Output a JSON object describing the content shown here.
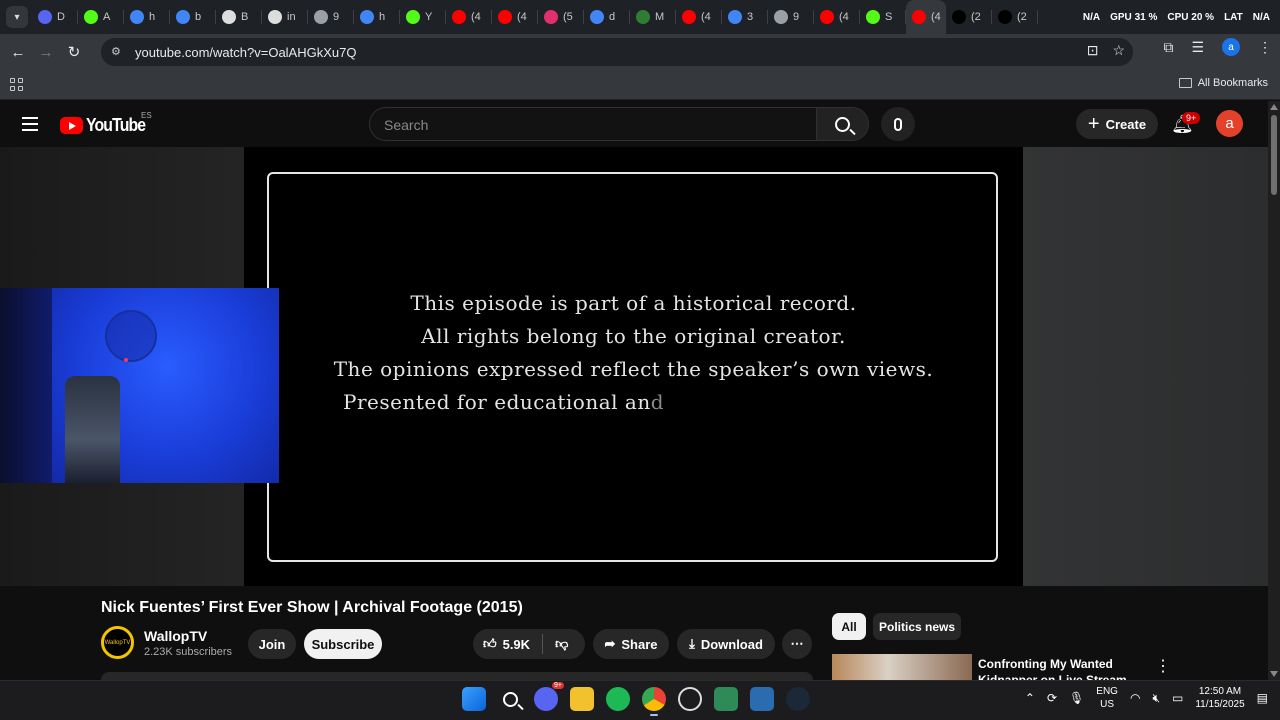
{
  "browser": {
    "tabs": [
      {
        "label": "D",
        "fav": "discord-icon",
        "color": "#5865f2"
      },
      {
        "label": "A",
        "fav": "kick-icon",
        "color": "#53fc18"
      },
      {
        "label": "h",
        "fav": "google-icon",
        "color": "#4285f4"
      },
      {
        "label": "b",
        "fav": "google-icon",
        "color": "#4285f4"
      },
      {
        "label": "B",
        "fav": "bold-b-icon",
        "color": "#dddddd"
      },
      {
        "label": "in",
        "fav": "bold-b-icon",
        "color": "#dddddd"
      },
      {
        "label": "9",
        "fav": "globe-icon",
        "color": "#9aa0a6"
      },
      {
        "label": "h",
        "fav": "google-icon",
        "color": "#4285f4"
      },
      {
        "label": "Y",
        "fav": "kick-icon",
        "color": "#53fc18"
      },
      {
        "label": "(4",
        "fav": "youtube-icon",
        "color": "#ff0000"
      },
      {
        "label": "(4",
        "fav": "youtube-icon",
        "color": "#ff0000"
      },
      {
        "label": "(5",
        "fav": "instagram-icon",
        "color": "#e1306c"
      },
      {
        "label": "d",
        "fav": "google-icon",
        "color": "#4285f4"
      },
      {
        "label": "M",
        "fav": "ship-icon",
        "color": "#2e7d32"
      },
      {
        "label": "(4",
        "fav": "youtube-icon",
        "color": "#ff0000"
      },
      {
        "label": "3",
        "fav": "google-icon",
        "color": "#4285f4"
      },
      {
        "label": "9",
        "fav": "globe-icon",
        "color": "#9aa0a6"
      },
      {
        "label": "(4",
        "fav": "youtube-icon",
        "color": "#ff0000"
      },
      {
        "label": "S",
        "fav": "kick-icon",
        "color": "#53fc18"
      },
      {
        "label": "(4",
        "fav": "youtube-icon",
        "color": "#ff0000",
        "active": true
      },
      {
        "label": "(2",
        "fav": "x-icon",
        "color": "#000000"
      },
      {
        "label": "(2",
        "fav": "x-icon",
        "color": "#000000"
      }
    ],
    "stats": {
      "gpu": "GPU",
      "gpu_val": "31 %",
      "cpu": "CPU",
      "cpu_val": "20 %",
      "na1": "N/A",
      "lat": "LAT",
      "na2": "N/A"
    },
    "url": "youtube.com/watch?v=OalAHGkXu7Q",
    "all_bookmarks": "All Bookmarks"
  },
  "youtube": {
    "logo_text": "YouTube",
    "country_code": "ES",
    "search_placeholder": "Search",
    "create_label": "Create",
    "notif_count": "9+",
    "avatar_letter": "a"
  },
  "video": {
    "disclaimer_lines": [
      "This episode is part of a historical record.",
      "All rights belong to the original creator.",
      "The opinions expressed reflect the speaker’s own views."
    ],
    "partial_line": "Presented for educational an",
    "partial_fade": "d",
    "title": "Nick Fuentes’ First Ever Show | Archival Footage (2015)",
    "channel": "WallopTV",
    "channel_logo_text": "WallopTV",
    "subscribers": "2.23K subscribers",
    "join_label": "Join",
    "subscribe_label": "Subscribe",
    "likes": "5.9K",
    "share_label": "Share",
    "download_label": "Download"
  },
  "sidebar": {
    "chips": [
      "All",
      "Politics news"
    ],
    "rec_title": "Confronting My Wanted Kidnapper on Live Stream"
  },
  "taskbar": {
    "lang": "ENG",
    "region": "US",
    "time": "12:50 AM",
    "date": "11/15/2025",
    "discord_badge": "9+"
  }
}
